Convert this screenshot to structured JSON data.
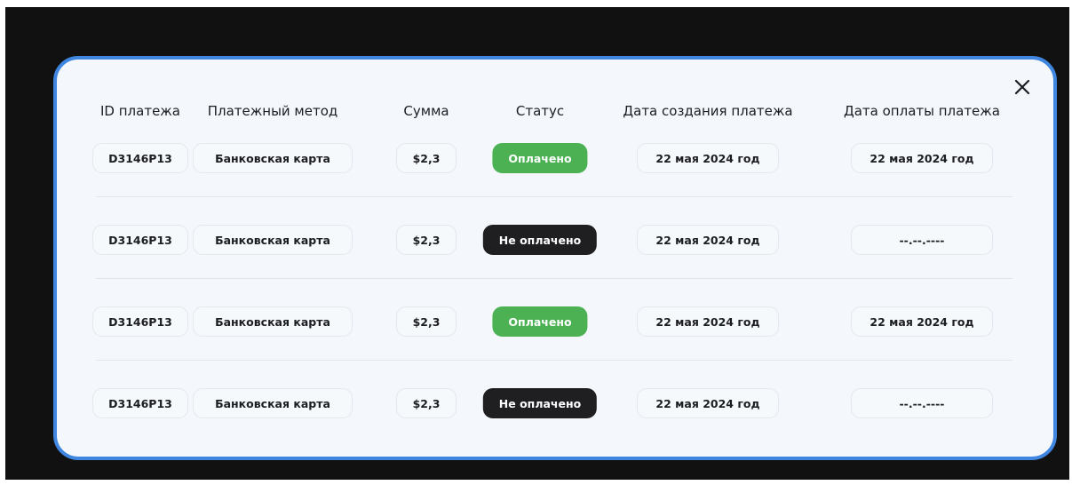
{
  "table": {
    "headers": {
      "id": "ID платежа",
      "method": "Платежный метод",
      "amount": "Сумма",
      "status": "Статус",
      "created": "Дата создания платежа",
      "paid": "Дата оплаты платежа"
    },
    "rows": [
      {
        "id": "D3146P13",
        "method": "Банковская карта",
        "amount": "$2,3",
        "status": "Оплачено",
        "status_kind": "paid",
        "created": "22 мая 2024 год",
        "paid": "22 мая 2024 год"
      },
      {
        "id": "D3146P13",
        "method": "Банковская карта",
        "amount": "$2,3",
        "status": "Не оплачено",
        "status_kind": "unpaid",
        "created": "22 мая 2024 год",
        "paid": "--.--.----"
      },
      {
        "id": "D3146P13",
        "method": "Банковская карта",
        "amount": "$2,3",
        "status": "Оплачено",
        "status_kind": "paid",
        "created": "22 мая 2024 год",
        "paid": "22 мая 2024 год"
      },
      {
        "id": "D3146P13",
        "method": "Банковская карта",
        "amount": "$2,3",
        "status": "Не оплачено",
        "status_kind": "unpaid",
        "created": "22 мая 2024 год",
        "paid": "--.--.----"
      }
    ]
  },
  "modal": {
    "close_icon": "close-icon"
  },
  "colors": {
    "accent_border": "#3f86e0",
    "paid": "#4cb152",
    "unpaid": "#1f1f22",
    "backdrop": "#111112"
  }
}
